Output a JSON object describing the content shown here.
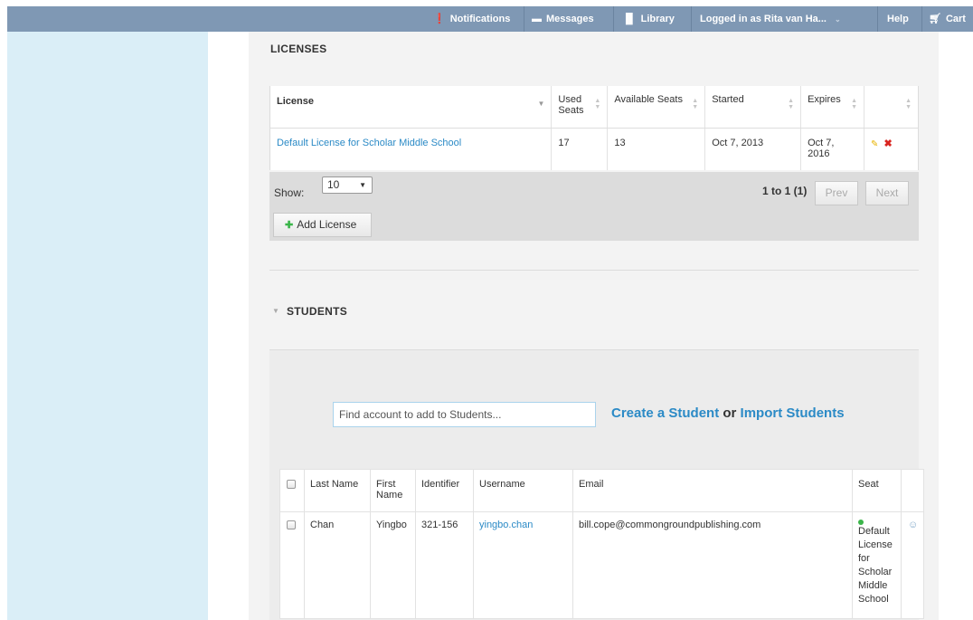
{
  "topbar": {
    "notifications": "Notifications",
    "messages": "Messages",
    "library": "Library",
    "logged_in": "Logged in as Rita van Ha...",
    "help": "Help",
    "cart": "Cart"
  },
  "licenses": {
    "title": "LICENSES",
    "columns": {
      "license": "License",
      "used_seats": "Used Seats",
      "available_seats": "Available Seats",
      "started": "Started",
      "expires": "Expires"
    },
    "rows": [
      {
        "license": "Default License for Scholar Middle School",
        "used_seats": "17",
        "available_seats": "13",
        "started": "Oct 7, 2013",
        "expires": "Oct 7, 2016"
      }
    ],
    "show_label": "Show:",
    "show_value": "10",
    "pagination": "1 to 1 (1)",
    "prev": "Prev",
    "next": "Next",
    "add_license": "Add License"
  },
  "students": {
    "title": "STUDENTS",
    "search_placeholder": "Find account to add to Students...",
    "create_student": "Create a Student",
    "or": "or",
    "import_students": "Import Students",
    "columns": {
      "last_name": "Last Name",
      "first_name": "First Name",
      "identifier": "Identifier",
      "username": "Username",
      "email": "Email",
      "seat": "Seat"
    },
    "rows": [
      {
        "last_name": "Chan",
        "first_name": "Yingbo",
        "identifier": "321-156",
        "username": "yingbo.chan",
        "email": "bill.cope@commongroundpublishing.com",
        "seat": "Default License for Scholar Middle School"
      }
    ]
  },
  "colors": {
    "topbar": "#7f98b4",
    "sidebar": "#daeef7",
    "link": "#2b8ac6",
    "seat_status": "#3bb54a"
  }
}
